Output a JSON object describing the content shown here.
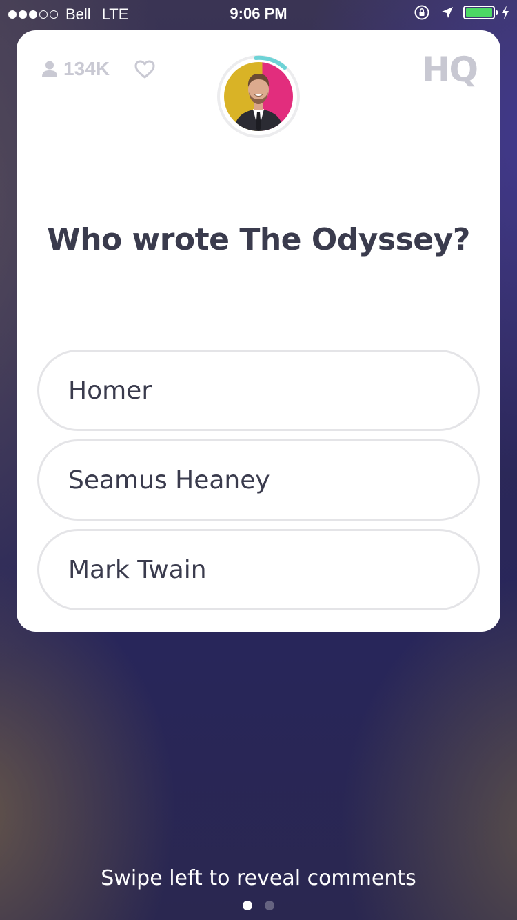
{
  "status_bar": {
    "carrier": "Bell",
    "network": "LTE",
    "time": "9:06 PM",
    "signal_bars_filled": 3,
    "signal_bars_total": 5,
    "battery_color": "#4cd964",
    "icons": [
      "orientation-lock-icon",
      "location-arrow-icon",
      "battery-icon",
      "charging-bolt-icon"
    ]
  },
  "header": {
    "viewer_count": "134K",
    "viewer_icon": "person-icon",
    "heart_icon": "heart-icon",
    "logo": "HQ"
  },
  "question": {
    "text": "Who wrote The Odyssey?"
  },
  "answers": [
    {
      "label": "Homer"
    },
    {
      "label": "Seamus Heaney"
    },
    {
      "label": "Mark Twain"
    }
  ],
  "footer": {
    "hint": "Swipe left to reveal comments",
    "pages_total": 2,
    "page_active": 1
  },
  "colors": {
    "accent_timer": "#6dd3d6",
    "text_dark": "#3a3b4d",
    "muted": "#c9c9d3"
  }
}
